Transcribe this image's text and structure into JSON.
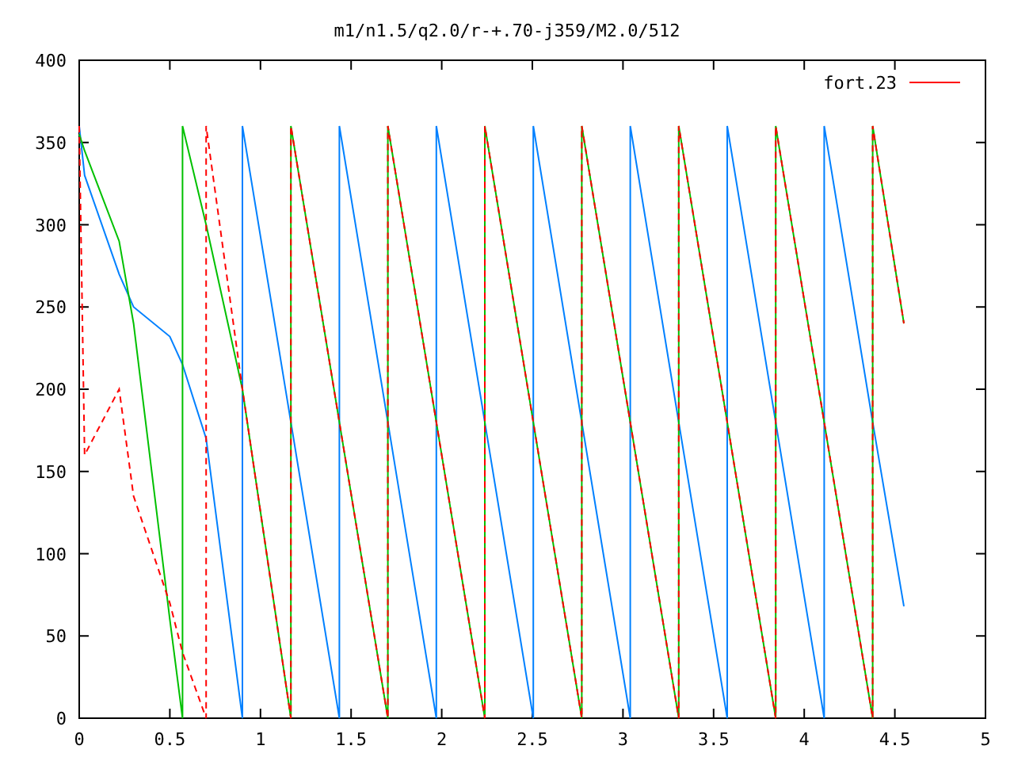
{
  "chart_data": {
    "type": "line",
    "title": "m1/n1.5/q2.0/r-+.70-j359/M2.0/512",
    "xlim": [
      0,
      5
    ],
    "ylim": [
      0,
      400
    ],
    "xticks": [
      0,
      0.5,
      1,
      1.5,
      2,
      2.5,
      3,
      3.5,
      4,
      4.5,
      5
    ],
    "yticks": [
      0,
      50,
      100,
      150,
      200,
      250,
      300,
      350,
      400
    ],
    "x": [
      0,
      0.03,
      0.22,
      0.3,
      0.5,
      0.57,
      0.57,
      0.7,
      0.7,
      0.9,
      0.9,
      1.1675,
      1.1675,
      1.435,
      1.435,
      1.7025,
      1.7025,
      1.97,
      1.97,
      2.2375,
      2.2375,
      2.505,
      2.505,
      2.7725,
      2.7725,
      3.04,
      3.04,
      3.3075,
      3.3075,
      3.575,
      3.575,
      3.8425,
      3.8425,
      4.11,
      4.11,
      4.3775,
      4.3775,
      4.55
    ],
    "series": [
      {
        "name": "fort.23",
        "color": "#ff0000",
        "line_style": "dashed",
        "values": [
          360,
          160,
          200,
          135,
          70,
          40,
          40,
          0,
          360,
          200,
          200,
          0,
          360,
          180,
          180,
          0,
          360,
          180,
          180,
          0,
          360,
          180,
          180,
          0,
          360,
          180,
          180,
          0,
          360,
          180,
          180,
          0,
          360,
          180,
          180,
          0,
          360,
          240
        ]
      },
      {
        "color": "#00c000",
        "values": [
          355,
          345,
          290,
          240,
          60,
          0,
          360,
          300,
          300,
          200,
          200,
          0,
          360,
          180,
          180,
          0,
          360,
          180,
          180,
          0,
          360,
          180,
          180,
          0,
          360,
          180,
          180,
          0,
          360,
          180,
          180,
          0,
          360,
          180,
          180,
          0,
          360,
          240
        ]
      },
      {
        "color": "#0080ff",
        "values": [
          360,
          330,
          270,
          250,
          232,
          215,
          215,
          170,
          170,
          0,
          360,
          180,
          180,
          0,
          360,
          180,
          180,
          0,
          360,
          180,
          180,
          0,
          360,
          180,
          180,
          0,
          360,
          180,
          180,
          0,
          360,
          180,
          180,
          0,
          360,
          180,
          180,
          68
        ]
      }
    ]
  }
}
